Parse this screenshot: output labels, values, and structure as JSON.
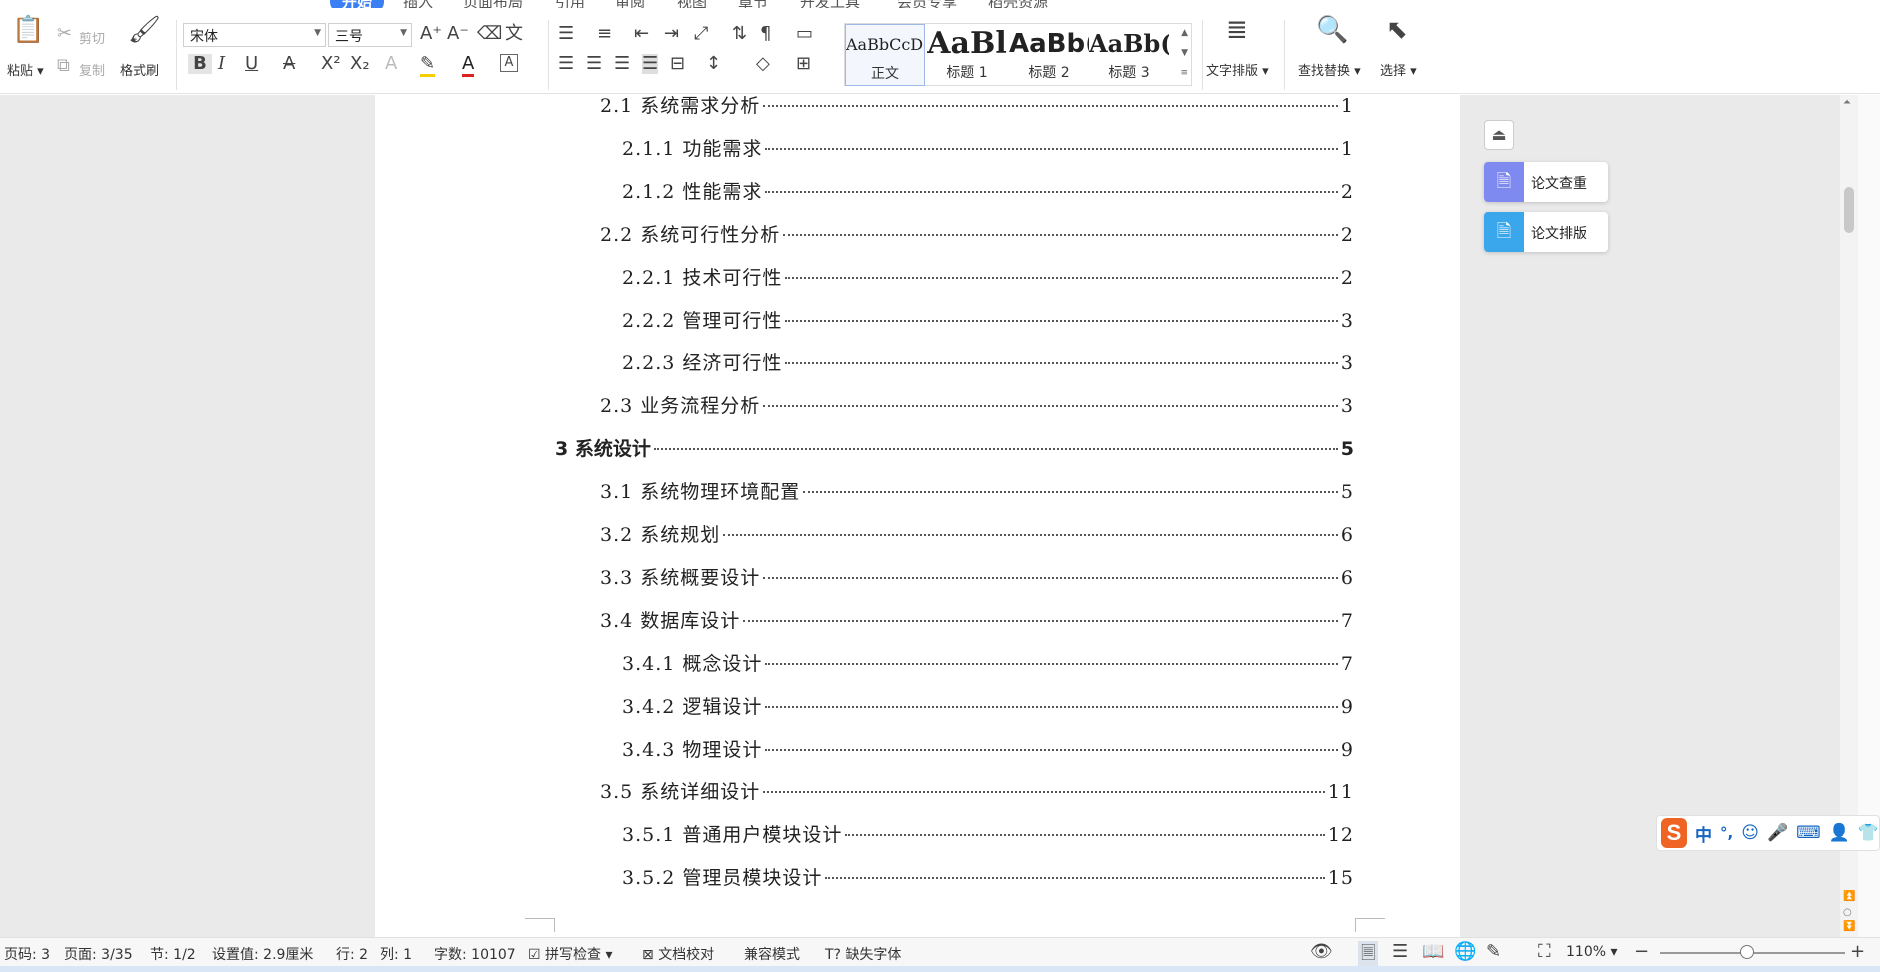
{
  "menu_tabs": [
    {
      "label": "开始",
      "active": true
    },
    {
      "label": "插入"
    },
    {
      "label": "页面布局"
    },
    {
      "label": "引用"
    },
    {
      "label": "审阅"
    },
    {
      "label": "视图"
    },
    {
      "label": "章节"
    },
    {
      "label": "开发工具"
    },
    {
      "label": "会员专享"
    },
    {
      "label": "稻壳资源"
    }
  ],
  "ribbon": {
    "clipboard": {
      "paste": "粘贴",
      "cut": "剪切",
      "copy": "复制",
      "format_painter": "格式刷"
    },
    "font": {
      "name": "宋体",
      "size": "三号"
    },
    "styles": [
      {
        "sample": "AaBbCcDd",
        "name": "正文"
      },
      {
        "sample": "AaBl",
        "name": "标题 1"
      },
      {
        "sample": "AaBb(",
        "name": "标题 2"
      },
      {
        "sample": "AaBb(",
        "name": "标题 3"
      }
    ],
    "text_layout": "文字排版",
    "find_replace": "查找替换",
    "select": "选择"
  },
  "toc": [
    {
      "text": "2.1  系统需求分析",
      "page": "1",
      "level": 2
    },
    {
      "text": "2.1.1  功能需求",
      "page": "1",
      "level": 3
    },
    {
      "text": "2.1.2  性能需求",
      "page": "2",
      "level": 3
    },
    {
      "text": "2.2  系统可行性分析",
      "page": "2",
      "level": 2
    },
    {
      "text": "2.2.1  技术可行性",
      "page": "2",
      "level": 3
    },
    {
      "text": "2.2.2  管理可行性",
      "page": "3",
      "level": 3
    },
    {
      "text": "2.2.3  经济可行性",
      "page": "3",
      "level": 3
    },
    {
      "text": "2.3  业务流程分析",
      "page": "3",
      "level": 2
    },
    {
      "text": "3 系统设计",
      "page": "5",
      "level": 1
    },
    {
      "text": "3.1  系统物理环境配置",
      "page": "5",
      "level": 2
    },
    {
      "text": "3.2  系统规划",
      "page": "6",
      "level": 2
    },
    {
      "text": "3.3  系统概要设计",
      "page": "6",
      "level": 2
    },
    {
      "text": "3.4  数据库设计",
      "page": "7",
      "level": 2
    },
    {
      "text": "3.4.1  概念设计",
      "page": "7",
      "level": 3
    },
    {
      "text": "3.4.2  逻辑设计",
      "page": "9",
      "level": 3
    },
    {
      "text": "3.4.3  物理设计",
      "page": "9",
      "level": 3
    },
    {
      "text": "3.5  系统详细设计",
      "page": "11",
      "level": 2
    },
    {
      "text": "3.5.1  普通用户模块设计",
      "page": "12",
      "level": 3
    },
    {
      "text": "3.5.2  管理员模块设计",
      "page": "15",
      "level": 3
    }
  ],
  "side_panel": {
    "plagiarism_check": "论文查重",
    "thesis_format": "论文排版"
  },
  "status": {
    "page_no": "页码: 3",
    "pages": "页面: 3/35",
    "section": "节: 1/2",
    "position": "设置值: 2.9厘米",
    "row": "行: 2",
    "col": "列: 1",
    "word_count": "字数: 10107",
    "spell_check": "拼写检查",
    "proofread": "文档校对",
    "compat_mode": "兼容模式",
    "missing_fonts": "缺失字体",
    "zoom": "110%"
  },
  "ime": {
    "lang": "中"
  }
}
